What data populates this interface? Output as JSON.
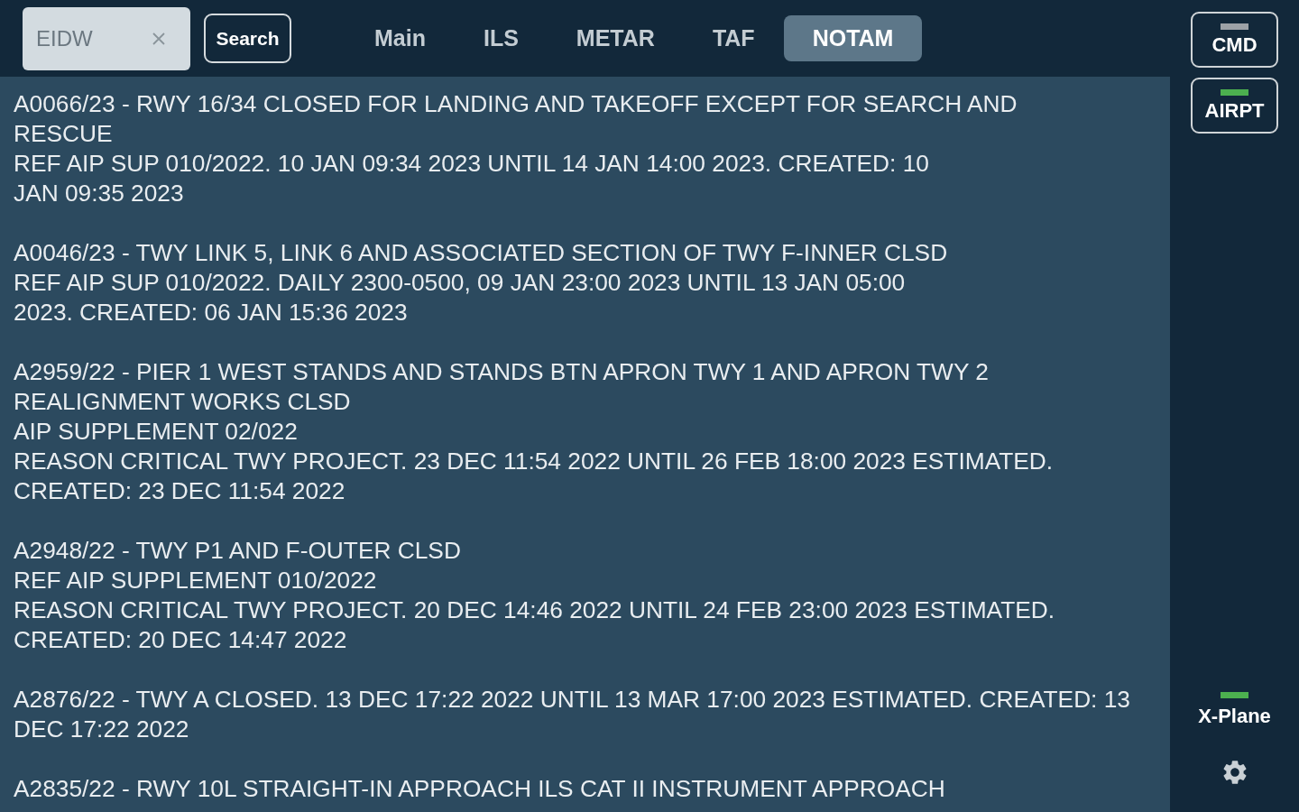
{
  "search": {
    "value": "EIDW",
    "button": "Search"
  },
  "tabs": [
    {
      "label": "Main",
      "selected": false
    },
    {
      "label": "ILS",
      "selected": false
    },
    {
      "label": "METAR",
      "selected": false
    },
    {
      "label": "TAF",
      "selected": false
    },
    {
      "label": "NOTAM",
      "selected": true
    }
  ],
  "notams": [
    {
      "lines": [
        "A0066/23 - RWY 16/34 CLOSED FOR LANDING AND TAKEOFF EXCEPT FOR SEARCH AND",
        "RESCUE",
        "REF AIP SUP 010/2022. 10 JAN 09:34 2023 UNTIL 14 JAN 14:00 2023. CREATED: 10",
        "JAN 09:35 2023"
      ]
    },
    {
      "lines": [
        "A0046/23 - TWY LINK 5, LINK 6 AND ASSOCIATED SECTION OF TWY F-INNER CLSD",
        "REF AIP SUP 010/2022. DAILY 2300-0500, 09 JAN 23:00 2023 UNTIL 13 JAN 05:00",
        "2023. CREATED: 06 JAN 15:36 2023"
      ]
    },
    {
      "lines": [
        "A2959/22 - PIER 1 WEST STANDS AND STANDS BTN APRON TWY 1 AND APRON TWY 2",
        "REALIGNMENT WORKS CLSD",
        "AIP SUPPLEMENT 02/022",
        "REASON CRITICAL TWY PROJECT. 23 DEC 11:54 2022 UNTIL 26 FEB 18:00 2023 ESTIMATED.",
        "CREATED: 23 DEC 11:54 2022"
      ]
    },
    {
      "lines": [
        "A2948/22 - TWY P1 AND F-OUTER CLSD",
        "REF AIP SUPPLEMENT 010/2022",
        "REASON CRITICAL TWY PROJECT. 20 DEC 14:46 2022 UNTIL 24 FEB 23:00 2023 ESTIMATED.",
        "CREATED: 20 DEC 14:47 2022"
      ]
    },
    {
      "lines": [
        "A2876/22 - TWY A CLOSED. 13 DEC 17:22 2022 UNTIL 13 MAR 17:00 2023 ESTIMATED. CREATED: 13",
        "DEC 17:22 2022"
      ]
    },
    {
      "lines": [
        "A2835/22 - RWY 10L STRAIGHT-IN APPROACH ILS CAT II INSTRUMENT APPROACH"
      ]
    }
  ],
  "sidebar": {
    "buttons": [
      {
        "label": "CMD",
        "on": false
      },
      {
        "label": "AIRPT",
        "on": true
      }
    ],
    "status": {
      "label": "X-Plane",
      "on": true
    }
  }
}
